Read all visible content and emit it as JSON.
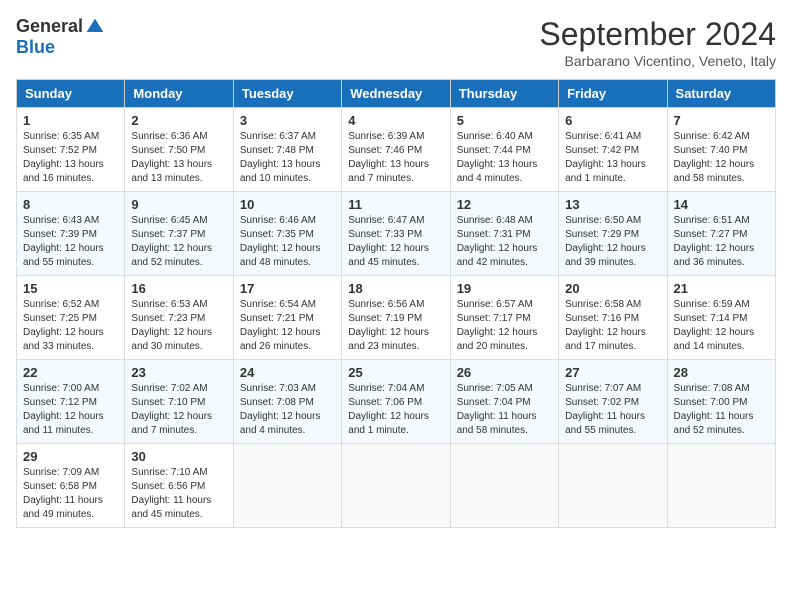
{
  "logo": {
    "general": "General",
    "blue": "Blue"
  },
  "title": "September 2024",
  "subtitle": "Barbarano Vicentino, Veneto, Italy",
  "headers": [
    "Sunday",
    "Monday",
    "Tuesday",
    "Wednesday",
    "Thursday",
    "Friday",
    "Saturday"
  ],
  "weeks": [
    [
      {
        "day": "1",
        "info": "Sunrise: 6:35 AM\nSunset: 7:52 PM\nDaylight: 13 hours and 16 minutes."
      },
      {
        "day": "2",
        "info": "Sunrise: 6:36 AM\nSunset: 7:50 PM\nDaylight: 13 hours and 13 minutes."
      },
      {
        "day": "3",
        "info": "Sunrise: 6:37 AM\nSunset: 7:48 PM\nDaylight: 13 hours and 10 minutes."
      },
      {
        "day": "4",
        "info": "Sunrise: 6:39 AM\nSunset: 7:46 PM\nDaylight: 13 hours and 7 minutes."
      },
      {
        "day": "5",
        "info": "Sunrise: 6:40 AM\nSunset: 7:44 PM\nDaylight: 13 hours and 4 minutes."
      },
      {
        "day": "6",
        "info": "Sunrise: 6:41 AM\nSunset: 7:42 PM\nDaylight: 13 hours and 1 minute."
      },
      {
        "day": "7",
        "info": "Sunrise: 6:42 AM\nSunset: 7:40 PM\nDaylight: 12 hours and 58 minutes."
      }
    ],
    [
      {
        "day": "8",
        "info": "Sunrise: 6:43 AM\nSunset: 7:39 PM\nDaylight: 12 hours and 55 minutes."
      },
      {
        "day": "9",
        "info": "Sunrise: 6:45 AM\nSunset: 7:37 PM\nDaylight: 12 hours and 52 minutes."
      },
      {
        "day": "10",
        "info": "Sunrise: 6:46 AM\nSunset: 7:35 PM\nDaylight: 12 hours and 48 minutes."
      },
      {
        "day": "11",
        "info": "Sunrise: 6:47 AM\nSunset: 7:33 PM\nDaylight: 12 hours and 45 minutes."
      },
      {
        "day": "12",
        "info": "Sunrise: 6:48 AM\nSunset: 7:31 PM\nDaylight: 12 hours and 42 minutes."
      },
      {
        "day": "13",
        "info": "Sunrise: 6:50 AM\nSunset: 7:29 PM\nDaylight: 12 hours and 39 minutes."
      },
      {
        "day": "14",
        "info": "Sunrise: 6:51 AM\nSunset: 7:27 PM\nDaylight: 12 hours and 36 minutes."
      }
    ],
    [
      {
        "day": "15",
        "info": "Sunrise: 6:52 AM\nSunset: 7:25 PM\nDaylight: 12 hours and 33 minutes."
      },
      {
        "day": "16",
        "info": "Sunrise: 6:53 AM\nSunset: 7:23 PM\nDaylight: 12 hours and 30 minutes."
      },
      {
        "day": "17",
        "info": "Sunrise: 6:54 AM\nSunset: 7:21 PM\nDaylight: 12 hours and 26 minutes."
      },
      {
        "day": "18",
        "info": "Sunrise: 6:56 AM\nSunset: 7:19 PM\nDaylight: 12 hours and 23 minutes."
      },
      {
        "day": "19",
        "info": "Sunrise: 6:57 AM\nSunset: 7:17 PM\nDaylight: 12 hours and 20 minutes."
      },
      {
        "day": "20",
        "info": "Sunrise: 6:58 AM\nSunset: 7:16 PM\nDaylight: 12 hours and 17 minutes."
      },
      {
        "day": "21",
        "info": "Sunrise: 6:59 AM\nSunset: 7:14 PM\nDaylight: 12 hours and 14 minutes."
      }
    ],
    [
      {
        "day": "22",
        "info": "Sunrise: 7:00 AM\nSunset: 7:12 PM\nDaylight: 12 hours and 11 minutes."
      },
      {
        "day": "23",
        "info": "Sunrise: 7:02 AM\nSunset: 7:10 PM\nDaylight: 12 hours and 7 minutes."
      },
      {
        "day": "24",
        "info": "Sunrise: 7:03 AM\nSunset: 7:08 PM\nDaylight: 12 hours and 4 minutes."
      },
      {
        "day": "25",
        "info": "Sunrise: 7:04 AM\nSunset: 7:06 PM\nDaylight: 12 hours and 1 minute."
      },
      {
        "day": "26",
        "info": "Sunrise: 7:05 AM\nSunset: 7:04 PM\nDaylight: 11 hours and 58 minutes."
      },
      {
        "day": "27",
        "info": "Sunrise: 7:07 AM\nSunset: 7:02 PM\nDaylight: 11 hours and 55 minutes."
      },
      {
        "day": "28",
        "info": "Sunrise: 7:08 AM\nSunset: 7:00 PM\nDaylight: 11 hours and 52 minutes."
      }
    ],
    [
      {
        "day": "29",
        "info": "Sunrise: 7:09 AM\nSunset: 6:58 PM\nDaylight: 11 hours and 49 minutes."
      },
      {
        "day": "30",
        "info": "Sunrise: 7:10 AM\nSunset: 6:56 PM\nDaylight: 11 hours and 45 minutes."
      },
      {
        "day": "",
        "info": ""
      },
      {
        "day": "",
        "info": ""
      },
      {
        "day": "",
        "info": ""
      },
      {
        "day": "",
        "info": ""
      },
      {
        "day": "",
        "info": ""
      }
    ]
  ]
}
